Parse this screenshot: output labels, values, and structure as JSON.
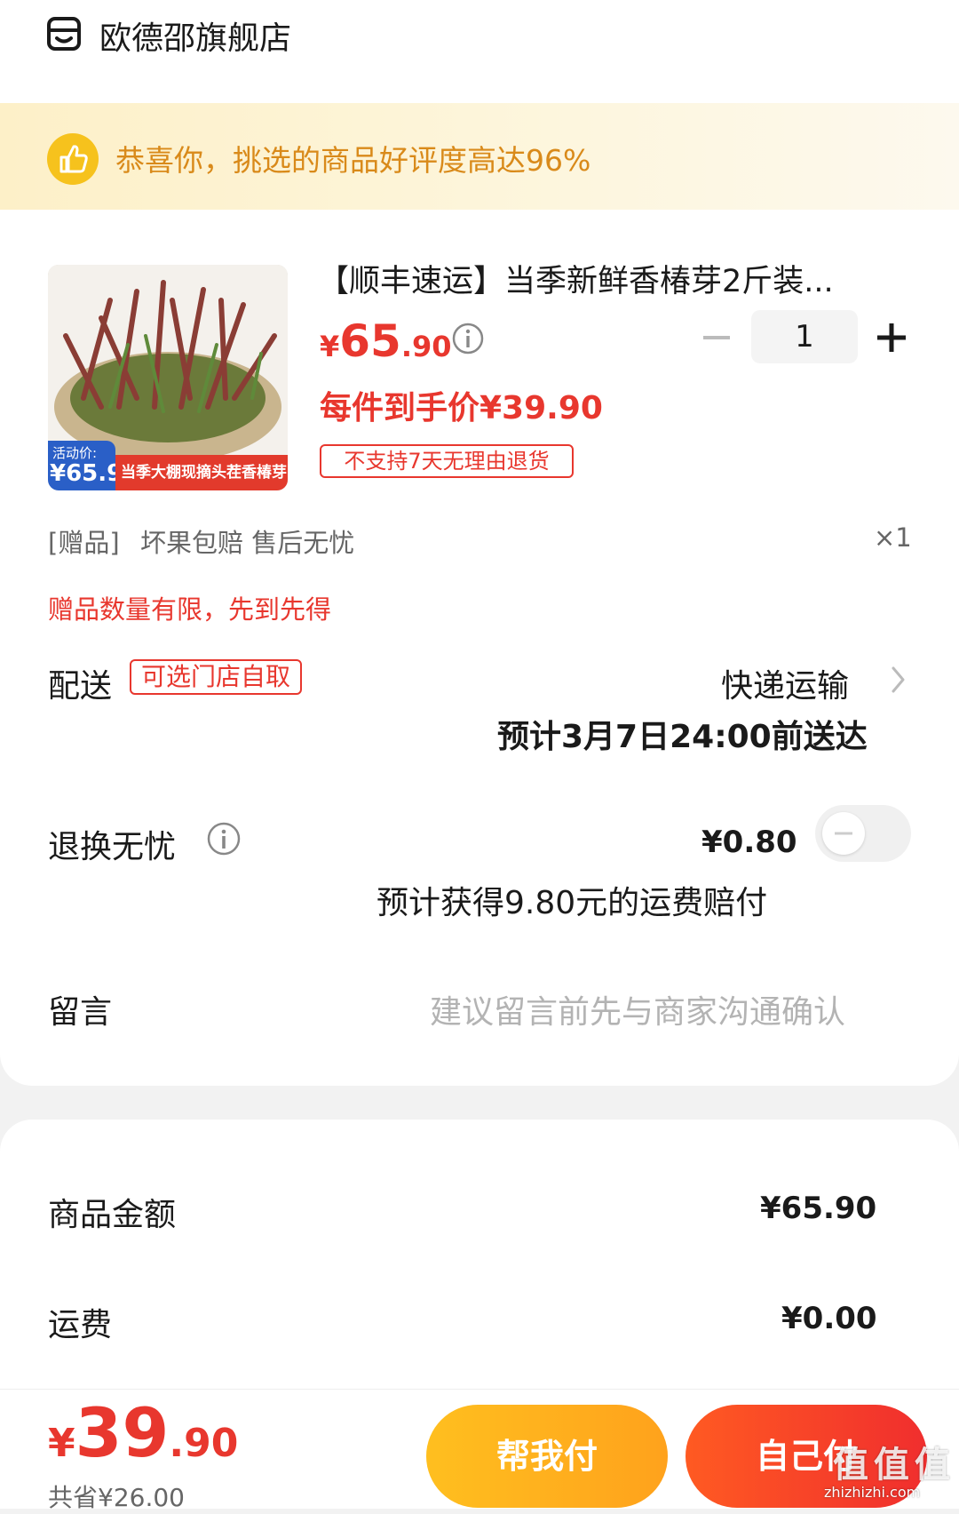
{
  "store": {
    "name": "欧德邵旗舰店",
    "icon": "store-icon"
  },
  "promo": {
    "text": "恭喜你，挑选的商品好评度高达96%",
    "icon": "thumbs-up-icon"
  },
  "product": {
    "title": "【顺丰速运】当季新鲜香椿芽2斤装...",
    "price_symbol": "¥",
    "price_int": "65",
    "price_dec": ".90",
    "final_price": "每件到手价¥39.90",
    "return_tag": "不支持7天无理由退货",
    "quantity": "1",
    "image_badge_label": "活动价:",
    "image_badge_price": "¥65.9",
    "image_caption": "当季大棚现摘头茬香椿芽"
  },
  "gift": {
    "tag": "[赠品]",
    "name": "坏果包赔 售后无忧",
    "qty": "×1",
    "notice": "赠品数量有限，先到先得"
  },
  "delivery": {
    "label": "配送",
    "pickup_tag": "可选门店自取",
    "method": "快递运输",
    "eta": "预计3月7日24:00前送达"
  },
  "returns": {
    "label": "退换无忧",
    "price": "¥0.80",
    "desc": "预计获得9.80元的运费赔付"
  },
  "message": {
    "label": "留言",
    "placeholder": "建议留言前先与商家沟通确认"
  },
  "summary": {
    "goods_label": "商品金额",
    "goods_value": "¥65.90",
    "shipping_label": "运费",
    "shipping_value": "¥0.00"
  },
  "footer": {
    "total_symbol": "¥",
    "total_int": "39",
    "total_dec": ".90",
    "saved": "共省¥26.00",
    "help_pay": "帮我付",
    "self_pay": "自己付",
    "watermark": "值 值 值",
    "watermark_url": "zhizhizhi.com"
  },
  "colors": {
    "accent_red": "#e8372e",
    "accent_yellow": "#f6c21d",
    "help_btn": "#ffb01e",
    "self_btn": "#f2362c"
  }
}
